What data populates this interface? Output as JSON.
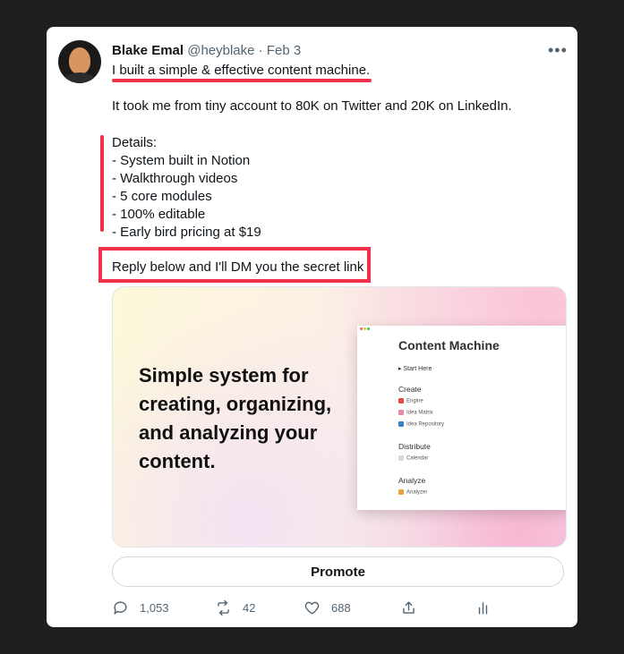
{
  "tweet": {
    "author_name": "Blake Emal",
    "handle": "@heyblake",
    "separator": "·",
    "date": "Feb 3",
    "line1": "I built a simple & effective content machine.",
    "line2": "It took me from tiny account to 80K on Twitter and 20K on LinkedIn.",
    "details": [
      "Details:",
      "- System built in Notion",
      "- Walkthrough videos",
      "- 5 core modules",
      "- 100% editable",
      "- Early bird pricing at $19"
    ],
    "reply_line": "Reply below and I'll DM you the secret link"
  },
  "media": {
    "headline": "Simple system for creating, organizing, and analyzing your content.",
    "notion": {
      "title": "Content Machine",
      "start": "▸ Start Here",
      "create_heading": "Create",
      "create_items": [
        "Engine",
        "Idea Matrix",
        "Idea Repository"
      ],
      "distribute_heading": "Distribute",
      "distribute_items": [
        "Calendar"
      ],
      "analyze_heading": "Analyze",
      "analyze_items": [
        "Analyzer"
      ]
    }
  },
  "promote_label": "Promote",
  "actions": {
    "replies": "1,053",
    "retweets": "42",
    "likes": "688"
  },
  "icons": {
    "more": "more-horizontal-icon",
    "reply": "reply-icon",
    "retweet": "retweet-icon",
    "like": "heart-icon",
    "share": "share-icon",
    "analytics": "analytics-icon"
  },
  "colors": {
    "highlight": "#f2304a",
    "muted_text": "#536471"
  }
}
